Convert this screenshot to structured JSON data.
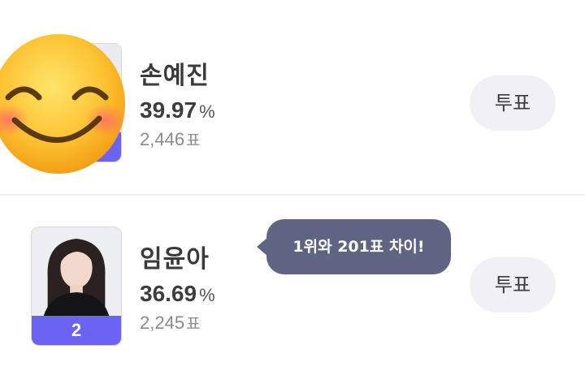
{
  "candidates": [
    {
      "name": "손예진",
      "percent": "39.97",
      "percent_unit": "%",
      "votes": "2,446",
      "votes_unit": "표",
      "rank": "",
      "vote_label": "투표"
    },
    {
      "name": "임윤아",
      "percent": "36.69",
      "percent_unit": "%",
      "votes": "2,245",
      "votes_unit": "표",
      "rank": "2",
      "vote_label": "투표"
    }
  ],
  "gap_bubble": "1위와 201표 차이!",
  "icons": {
    "overlay": "smiling-face-emoji-icon"
  },
  "colors": {
    "accent": "#6b63f4",
    "bubble": "#5f6483",
    "button_bg": "#f0f0f6",
    "divider": "#efeff2"
  }
}
